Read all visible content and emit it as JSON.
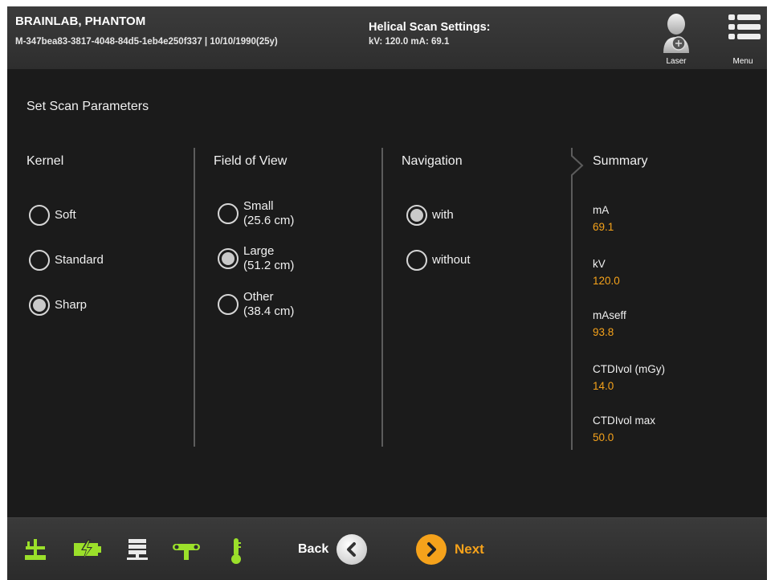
{
  "header": {
    "patient_name": "BRAINLAB, PHANTOM",
    "patient_info": "M-347bea83-3817-4048-84d5-1eb4e250f337 | 10/10/1990(25y)",
    "scan_title": "Helical Scan Settings:",
    "scan_values": "kV:  120.0   mA:  69.1",
    "laser_label": "Laser",
    "menu_label": "Menu",
    "laser_icon": "laser-person-icon",
    "menu_icon": "menu-icon"
  },
  "main": {
    "title": "Set Scan Parameters",
    "kernel": {
      "heading": "Kernel",
      "options": [
        {
          "label": "Soft",
          "selected": false
        },
        {
          "label": "Standard",
          "selected": false
        },
        {
          "label": "Sharp",
          "selected": true
        }
      ]
    },
    "fov": {
      "heading": "Field of View",
      "options": [
        {
          "line1": "Small",
          "line2": "(25.6 cm)",
          "selected": false
        },
        {
          "line1": "Large",
          "line2": "(51.2 cm)",
          "selected": true
        },
        {
          "line1": "Other",
          "line2": "(38.4 cm)",
          "selected": false
        }
      ]
    },
    "navigation": {
      "heading": "Navigation",
      "options": [
        {
          "label": "with",
          "selected": true
        },
        {
          "label": "without",
          "selected": false
        }
      ]
    },
    "summary": {
      "heading": "Summary",
      "items": [
        {
          "label": "mA",
          "value": "69.1"
        },
        {
          "label": "kV",
          "value": "120.0"
        },
        {
          "label": "mAseff",
          "value": "93.8"
        },
        {
          "label": "CTDIvol (mGy)",
          "value": "14.0"
        },
        {
          "label": "CTDIvol max",
          "value": "50.0"
        }
      ]
    }
  },
  "footer": {
    "back_label": "Back",
    "next_label": "Next",
    "icons": [
      "table-position-icon",
      "power-icon",
      "network-server-icon",
      "gantry-tool-icon",
      "thermometer-icon"
    ]
  },
  "colors": {
    "accent": "#f5a21b",
    "icon_green": "#9be02a",
    "background": "#1b1b1b"
  }
}
